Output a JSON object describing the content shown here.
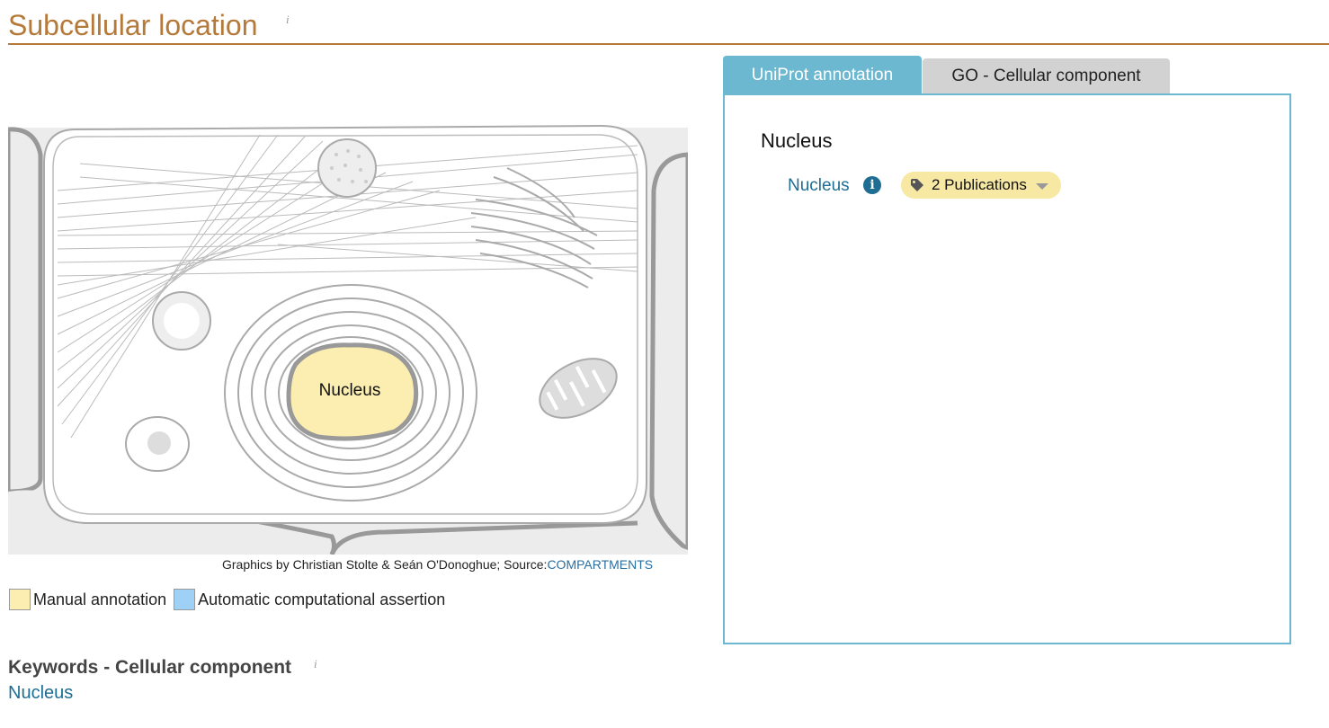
{
  "section": {
    "title": "Subcellular location",
    "info_marker": "i"
  },
  "figure": {
    "nucleus_label": "Nucleus",
    "credit_text": "Graphics by Christian Stolte & Seán O'Donoghue; Source:",
    "credit_link": "COMPARTMENTS"
  },
  "legend": {
    "items": [
      {
        "label": "Manual annotation",
        "color": "#fbeeb0"
      },
      {
        "label": "Automatic computational assertion",
        "color": "#9fd1f7"
      }
    ]
  },
  "tabs": {
    "items": [
      {
        "label": "UniProt annotation",
        "active": true
      },
      {
        "label": "GO - Cellular component",
        "active": false
      }
    ]
  },
  "panel": {
    "heading": "Nucleus",
    "location_link": "Nucleus",
    "info_icon": "info-icon",
    "publications_label": "2 Publications"
  },
  "keywords": {
    "title": "Keywords - Cellular component",
    "info_marker": "i",
    "items": [
      "Nucleus"
    ]
  },
  "colors": {
    "title_brown": "#b5793a",
    "tab_active_blue": "#6cb8d1",
    "link_blue": "#1f6d92",
    "nucleus_fill": "#fbeeb0",
    "badge_fill": "#f7e8a4"
  }
}
